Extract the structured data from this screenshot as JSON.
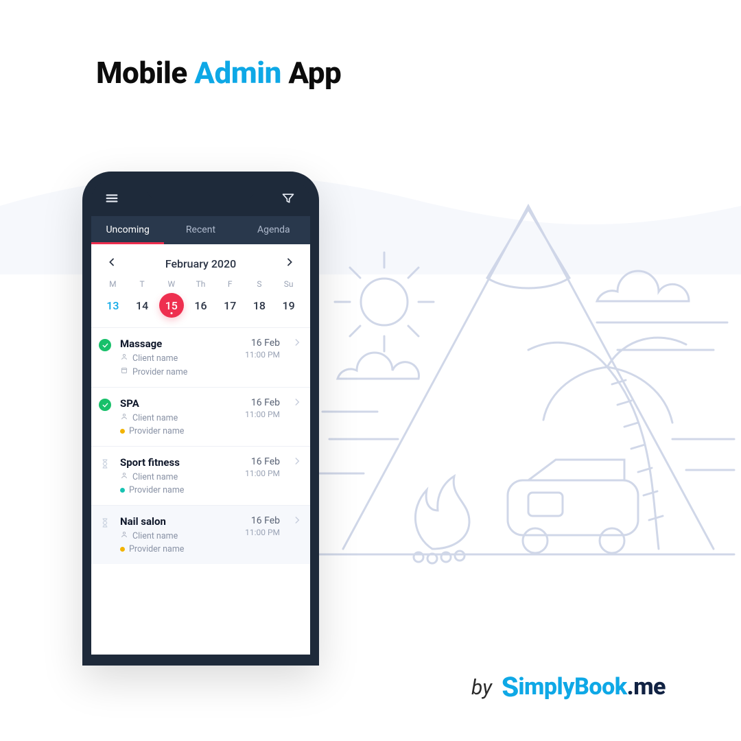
{
  "headline": {
    "pre": "Mobile ",
    "accent": "Admin",
    "post": " App"
  },
  "tabs": [
    {
      "label": "Uncoming",
      "active": true
    },
    {
      "label": "Recent",
      "active": false
    },
    {
      "label": "Agenda",
      "active": false
    }
  ],
  "month": {
    "label": "February 2020"
  },
  "weekdays": [
    "M",
    "T",
    "W",
    "Th",
    "F",
    "S",
    "Su"
  ],
  "dates": [
    {
      "n": "13",
      "today": true
    },
    {
      "n": "14"
    },
    {
      "n": "15",
      "selected": true
    },
    {
      "n": "16"
    },
    {
      "n": "17"
    },
    {
      "n": "18"
    },
    {
      "n": "19"
    }
  ],
  "bookings": [
    {
      "status": "ok",
      "title": "Massage",
      "client": "Client name",
      "provider": "Provider name",
      "provider_icon": "shop",
      "dot": null,
      "date": "16 Feb",
      "time": "11:00 PM"
    },
    {
      "status": "ok",
      "title": "SPA",
      "client": "Client name",
      "provider": "Provider name",
      "provider_icon": "dot",
      "dot": "#f2b300",
      "date": "16 Feb",
      "time": "11:00 PM"
    },
    {
      "status": "wait",
      "title": "Sport fitness",
      "client": "Client name",
      "provider": "Provider name",
      "provider_icon": "dot",
      "dot": "#17c3b2",
      "date": "16 Feb",
      "time": "11:00 PM"
    },
    {
      "status": "wait",
      "title": "Nail salon",
      "client": "Client name",
      "provider": "Provider name",
      "provider_icon": "dot",
      "dot": "#f2b300",
      "date": "16 Feb",
      "time": "11:00 PM"
    }
  ],
  "brand": {
    "by": "by",
    "name1": "S",
    "name2": "implyBook",
    "dot": ".",
    "me": "me"
  }
}
